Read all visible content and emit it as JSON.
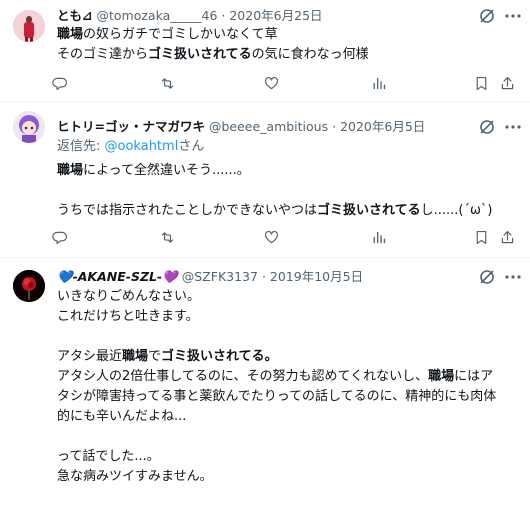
{
  "tweets": [
    {
      "name": "とも⊿",
      "handle": "@tomozaka_____46",
      "sep": "·",
      "date": "2020年6月25日",
      "lines": [
        [
          {
            "t": "職場",
            "b": true
          },
          {
            "t": "の奴らガチでゴミしかいなくて草",
            "b": false
          }
        ],
        [
          {
            "t": "そのゴミ達から",
            "b": false
          },
          {
            "t": "ゴミ扱いされてる",
            "b": true
          },
          {
            "t": "の気に食わなっ何様",
            "b": false
          }
        ]
      ]
    },
    {
      "name": "ヒトリ=ゴッ・ナマガワキ",
      "handle": "@beeee_ambitious",
      "sep": "·",
      "date": "2020年6月5日",
      "reply_prefix": "返信先: ",
      "reply_to": "@ookahtml",
      "reply_suffix": "さん",
      "lines": [
        [
          {
            "t": "職場",
            "b": true
          },
          {
            "t": "によって全然違いそう......。",
            "b": false
          }
        ],
        [],
        [
          {
            "t": "うちでは指示されたことしかできないやつは",
            "b": false
          },
          {
            "t": "ゴミ扱いされてる",
            "b": true
          },
          {
            "t": "し......(´ω`)",
            "b": false
          }
        ]
      ]
    },
    {
      "name": "💙-AKANE-SZL-💜",
      "handle": "@SZFK3137",
      "sep": "·",
      "date": "2019年10月5日",
      "lines": [
        [
          {
            "t": "いきなりごめんなさい。",
            "b": false
          }
        ],
        [
          {
            "t": "これだけちと吐きます。",
            "b": false
          }
        ],
        [],
        [
          {
            "t": "アタシ最近",
            "b": false
          },
          {
            "t": "職場",
            "b": true
          },
          {
            "t": "で",
            "b": false
          },
          {
            "t": "ゴミ扱いされてる。",
            "b": true
          }
        ],
        [
          {
            "t": "アタシ人の2倍仕事してるのに、その努力も認めてくれないし、",
            "b": false
          },
          {
            "t": "職場",
            "b": true
          },
          {
            "t": "にはア",
            "b": false
          }
        ],
        [
          {
            "t": "タシが障害持ってる事と薬飲んでたりっての話してるのに、精神的にも肉体",
            "b": false
          }
        ],
        [
          {
            "t": "的にも辛いんだよね...",
            "b": false
          }
        ],
        [],
        [
          {
            "t": "って話でした...。",
            "b": false
          }
        ],
        [
          {
            "t": "急な病みツイすみません。",
            "b": false
          }
        ]
      ]
    }
  ],
  "icons": [
    "grok-icon",
    "more-icon",
    "reply-icon",
    "retweet-icon",
    "like-icon",
    "views-icon",
    "bookmark-icon",
    "share-icon"
  ]
}
